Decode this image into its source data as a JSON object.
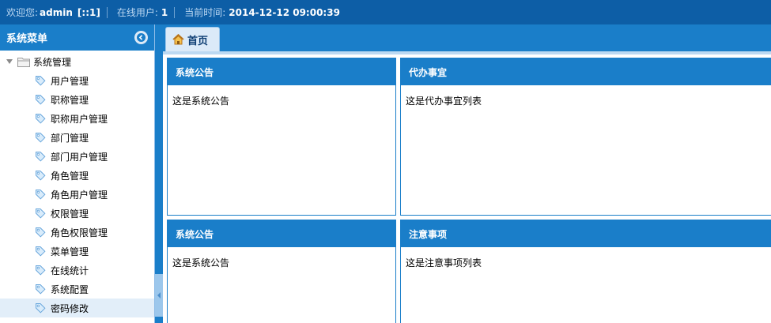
{
  "topbar": {
    "welcome_label": "欢迎您:",
    "user": "admin",
    "ip": "[::1]",
    "online_label": "在线用户:",
    "online_count": "1",
    "time_label": "当前时间:",
    "time_value": "2014-12-12 09:00:39"
  },
  "sidebar": {
    "title": "系统菜单",
    "root": "系统管理",
    "items": [
      {
        "label": "用户管理"
      },
      {
        "label": "职称管理"
      },
      {
        "label": "职称用户管理"
      },
      {
        "label": "部门管理"
      },
      {
        "label": "部门用户管理"
      },
      {
        "label": "角色管理"
      },
      {
        "label": "角色用户管理"
      },
      {
        "label": "权限管理"
      },
      {
        "label": "角色权限管理"
      },
      {
        "label": "菜单管理"
      },
      {
        "label": "在线统计"
      },
      {
        "label": "系统配置"
      },
      {
        "label": "密码修改"
      }
    ],
    "active_index": 12
  },
  "tabs": [
    {
      "label": "首页",
      "icon": "home-icon"
    }
  ],
  "panels": [
    {
      "title": "系统公告",
      "body": "这是系统公告"
    },
    {
      "title": "代办事宜",
      "body": "这是代办事宜列表"
    },
    {
      "title": "系统公告",
      "body": "这是系统公告"
    },
    {
      "title": "注意事项",
      "body": "这是注意事项列表"
    }
  ],
  "colors": {
    "topbar": "#0d5ea6",
    "accent": "#1a7ec9",
    "active_row": "#e2eef9"
  }
}
